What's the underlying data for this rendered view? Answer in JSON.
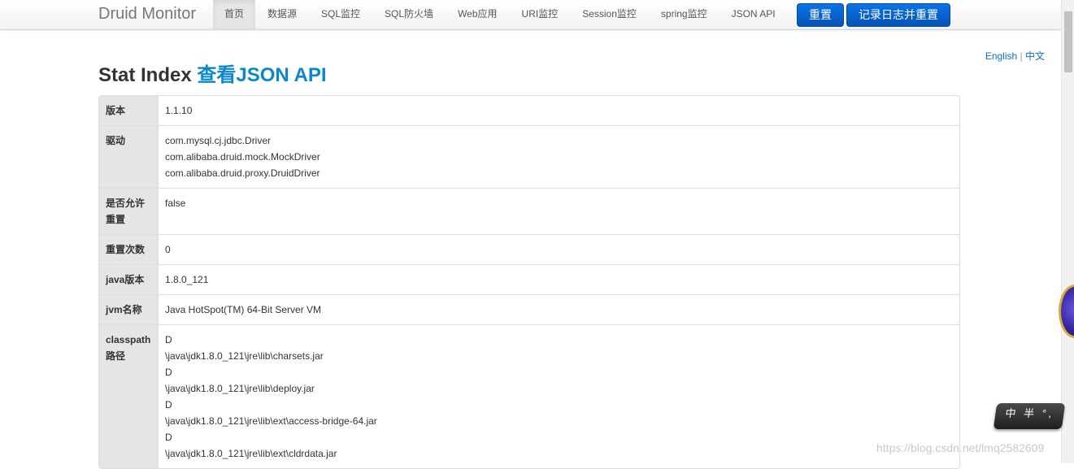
{
  "brand": "Druid Monitor",
  "nav": [
    {
      "label": "首页",
      "active": true
    },
    {
      "label": "数据源"
    },
    {
      "label": "SQL监控"
    },
    {
      "label": "SQL防火墙"
    },
    {
      "label": "Web应用"
    },
    {
      "label": "URI监控"
    },
    {
      "label": "Session监控"
    },
    {
      "label": "spring监控"
    },
    {
      "label": "JSON API"
    }
  ],
  "buttons": {
    "reset": "重置",
    "log_reset": "记录日志并重置"
  },
  "lang": {
    "english": "English",
    "sep": "|",
    "chinese": "中文"
  },
  "title": {
    "main": "Stat Index",
    "link": "查看JSON API"
  },
  "rows": [
    {
      "key": "版本",
      "values": [
        "1.1.10"
      ]
    },
    {
      "key": "驱动",
      "values": [
        "com.mysql.cj.jdbc.Driver",
        "com.alibaba.druid.mock.MockDriver",
        "com.alibaba.druid.proxy.DruidDriver"
      ]
    },
    {
      "key": "是否允许重置",
      "values": [
        "false"
      ]
    },
    {
      "key": "重置次数",
      "values": [
        "0"
      ]
    },
    {
      "key": "java版本",
      "values": [
        "1.8.0_121"
      ]
    },
    {
      "key": "jvm名称",
      "values": [
        "Java HotSpot(TM) 64-Bit Server VM"
      ]
    },
    {
      "key": "classpath路径",
      "values": [
        "D",
        "\\java\\jdk1.8.0_121\\jre\\lib\\charsets.jar",
        "D",
        "\\java\\jdk1.8.0_121\\jre\\lib\\deploy.jar",
        "D",
        "\\java\\jdk1.8.0_121\\jre\\lib\\ext\\access-bridge-64.jar",
        "D",
        "\\java\\jdk1.8.0_121\\jre\\lib\\ext\\cldrdata.jar"
      ]
    }
  ],
  "ime": "中 半 °,",
  "watermark": "https://blog.csdn.net/lmq2582609"
}
